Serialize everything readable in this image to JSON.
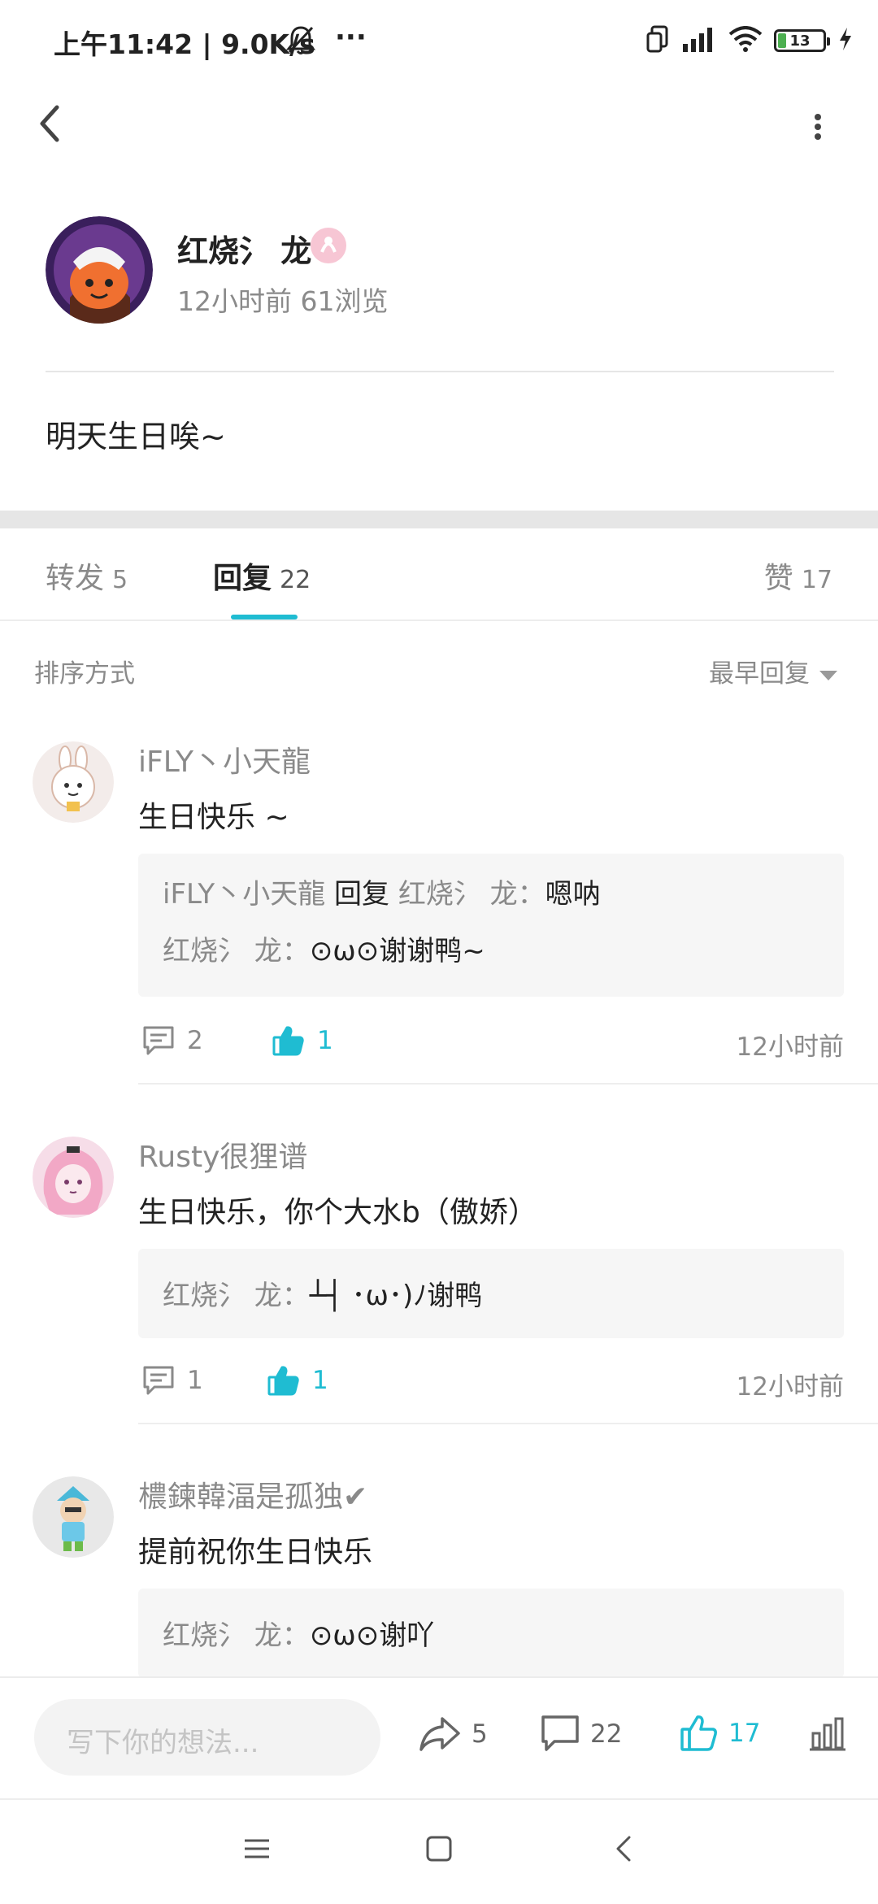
{
  "status_bar": {
    "time_net": "上午11:42 | 9.0K/s",
    "more": "···",
    "battery": "13",
    "icons": [
      "bell-off-icon",
      "dual-sim-icon",
      "signal-icon",
      "wifi-icon",
      "battery-icon",
      "charging-icon"
    ]
  },
  "post": {
    "author": "红烧氵 龙",
    "meta": "12小时前  61浏览",
    "text": "明天生日唉~"
  },
  "tabs": [
    {
      "label": "转发",
      "count": "5"
    },
    {
      "label": "回复",
      "count": "22"
    },
    {
      "label": "赞",
      "count": "17"
    }
  ],
  "sort": {
    "label": "排序方式",
    "value": "最早回复"
  },
  "comments": [
    {
      "name": "iFLY丶小天龍",
      "text": "生日快乐 ~",
      "replies": [
        {
          "from": "iFLY丶小天龍",
          "verb": "回复",
          "to": "红烧氵 龙",
          "content": "嗯呐"
        },
        {
          "from": "红烧氵 龙",
          "content": "⊙ω⊙谢谢鸭~"
        }
      ],
      "comment_count": "2",
      "like_count": "1",
      "time": "12小时前"
    },
    {
      "name": "Rusty很狸谱",
      "text": "生日快乐，你个大水b（傲娇）",
      "replies": [
        {
          "from": "红烧氵 龙",
          "content": "┴┤ ･ω･)ﾉ谢鸭"
        }
      ],
      "comment_count": "1",
      "like_count": "1",
      "time": "12小时前"
    },
    {
      "name": "檂鍊韓湢是孤独✔",
      "text": "提前祝你生日快乐",
      "replies": [
        {
          "from": "红烧氵 龙",
          "content": "⊙ω⊙谢吖"
        }
      ]
    }
  ],
  "bottom_bar": {
    "input_placeholder": "写下你的想法...",
    "share_count": "5",
    "comment_count": "22",
    "like_count": "17"
  },
  "colors": {
    "accent": "#1fbcd2",
    "text_primary": "#222222",
    "text_secondary": "#8a8a8a",
    "reply_bg": "#f6f6f6"
  }
}
